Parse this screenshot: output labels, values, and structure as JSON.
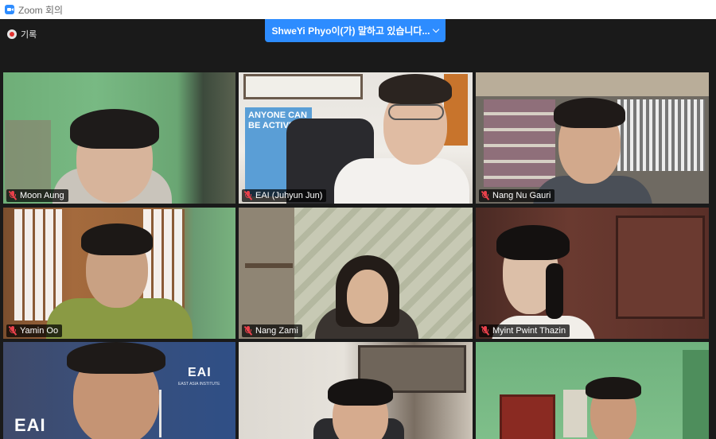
{
  "window": {
    "title": "Zoom 회의"
  },
  "meeting": {
    "recording_label": "기록",
    "speaker_banner": "ShweYi  Phyo이(가) 말하고 있습니다...",
    "participants": [
      {
        "name": "Moon Aung",
        "muted": true
      },
      {
        "name": "EAI (Juhyun Jun)",
        "muted": true
      },
      {
        "name": "Nang Nu Gauri",
        "muted": true
      },
      {
        "name": "Yamin Oo",
        "muted": true
      },
      {
        "name": "Nang Zami",
        "muted": true
      },
      {
        "name": "Myint Pwint Thazin",
        "muted": true
      },
      {
        "name": "",
        "muted": false
      },
      {
        "name": "",
        "muted": false
      },
      {
        "name": "",
        "muted": false
      }
    ],
    "background_texts": {
      "poster": "ANYONE CAN BE ACTIVE",
      "eai_logo": "EAI",
      "eai_logo_sub": "EAST ASIA INSTITUTE"
    }
  },
  "colors": {
    "accent": "#2d8cff",
    "meeting_bg": "#1a1a1a",
    "muted_icon": "#e8414b",
    "recording_dot": "#e0312f"
  },
  "icons": [
    "zoom-app-icon",
    "recording-icon",
    "chevron-down-icon",
    "mic-muted-icon"
  ]
}
